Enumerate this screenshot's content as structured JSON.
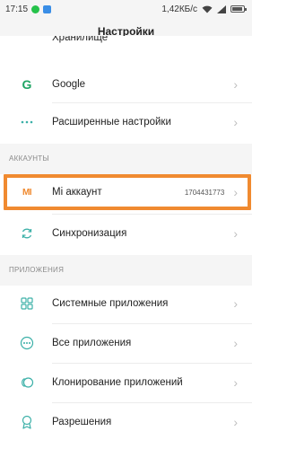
{
  "status_bar": {
    "time": "17:15",
    "speed": "1,42КБ/с"
  },
  "header": {
    "title": "Настройки"
  },
  "top_partial": {
    "label": "Хранилище"
  },
  "rows_top": [
    {
      "label": "Google",
      "icon": "google-icon"
    },
    {
      "label": "Расширенные настройки",
      "icon": "more-dots-icon"
    }
  ],
  "accounts": {
    "section_title": "АККАУНТЫ",
    "mi_account": {
      "label": "Mi аккаунт",
      "value": "1704431773",
      "icon": "mi-logo-icon"
    },
    "sync": {
      "label": "Синхронизация",
      "icon": "sync-icon"
    }
  },
  "apps": {
    "section_title": "ПРИЛОЖЕНИЯ",
    "items": [
      {
        "label": "Системные приложения",
        "icon": "grid-icon"
      },
      {
        "label": "Все приложения",
        "icon": "apps-dots-icon"
      },
      {
        "label": "Клонирование приложений",
        "icon": "clone-icon"
      },
      {
        "label": "Разрешения",
        "icon": "permissions-icon"
      }
    ]
  },
  "colors": {
    "accent_icon": "#3cb0a8",
    "mi_orange": "#f08a30",
    "google_green": "#1fa463"
  }
}
